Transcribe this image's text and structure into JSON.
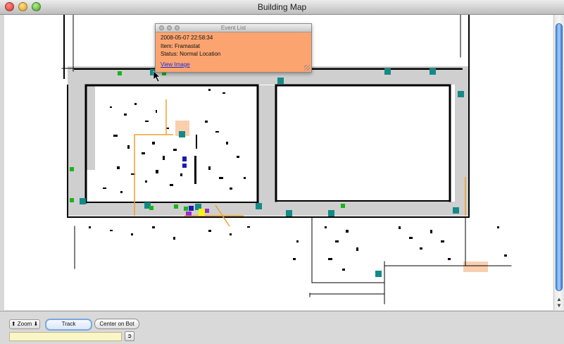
{
  "window": {
    "title": "Building Map"
  },
  "event_popup": {
    "title": "Event List",
    "timestamp": "2008-05-07 22:58:34",
    "item": "Item: Framastat",
    "status": "Status: Normal Location",
    "link_label": "View Image"
  },
  "toolbar": {
    "zoom_label": "⬆ Zoom ⬇",
    "track_label": "Track",
    "center_label": "Center on Bot",
    "go_glyph": "➲"
  },
  "colors": {
    "marker_teal": "#138a86",
    "marker_green": "#18b418",
    "marker_blue": "#1a1ab0",
    "marker_purple": "#9a2ad0",
    "marker_yellow": "#f5f512",
    "corridor_gray": "#cfcfcf",
    "path_orange": "#f1a12a",
    "room_peach": "#f9cfae",
    "popup_bg": "#fca470"
  }
}
